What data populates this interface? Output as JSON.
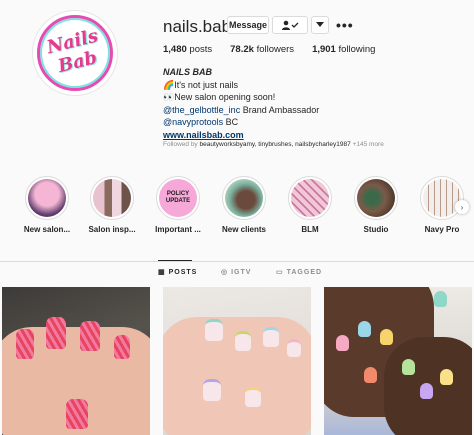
{
  "profile": {
    "username": "nails.bab",
    "logo_text": "Nails Bab",
    "buttons": {
      "message": "Message",
      "follow_icon": "person-check-icon",
      "dropdown_icon": "chevron-down-icon",
      "more": "•••"
    },
    "stats": {
      "posts_count": "1,480",
      "posts_label": "posts",
      "followers_count": "78.2k",
      "followers_label": "followers",
      "following_count": "1,901",
      "following_label": "following"
    },
    "bio": {
      "name": "NAILS BAB",
      "line1": "🌈It's not just nails",
      "line2": "👀New salon opening soon!",
      "line3_tag": "@the_gelbottle_inc",
      "line3_rest": " Brand Ambassador",
      "line4_tag": "@navyprotools",
      "line4_rest": " BC",
      "link": "www.nailsbab.com"
    },
    "followed_by": {
      "prefix": "Followed by ",
      "names": "beautyworksbyamy, tinybrushes, nailsbycharley1987",
      "suffix": " +145 more"
    }
  },
  "highlights": [
    {
      "label": "New salon...",
      "colors": [
        "#f4b6d4",
        "#5c3b6b"
      ]
    },
    {
      "label": "Salon insp...",
      "colors": [
        "#e8c2cf",
        "#8a6a5c"
      ]
    },
    {
      "label": "Important ...",
      "line1": "POLICY",
      "line2": "UPDATE",
      "colors": [
        "#f6a8d8",
        "#f6a8d8"
      ]
    },
    {
      "label": "New clients",
      "colors": [
        "#7bb4a3",
        "#6a4a3c"
      ]
    },
    {
      "label": "BLM",
      "colors": [
        "#f2c8d8",
        "#c97aa0"
      ]
    },
    {
      "label": "Studio",
      "colors": [
        "#7a5a48",
        "#3a6a4a"
      ]
    },
    {
      "label": "Navy Pro",
      "colors": [
        "#f2eeee",
        "#b89a86"
      ]
    }
  ],
  "tabs": [
    {
      "label": "POSTS",
      "icon": "grid-icon",
      "active": true
    },
    {
      "label": "IGTV",
      "icon": "tv-icon",
      "active": false
    },
    {
      "label": "TAGGED",
      "icon": "tag-icon",
      "active": false
    }
  ],
  "colors": {
    "accent_pink": "#e6398f",
    "link_blue": "#00376b",
    "muted": "#8e8e8e"
  }
}
